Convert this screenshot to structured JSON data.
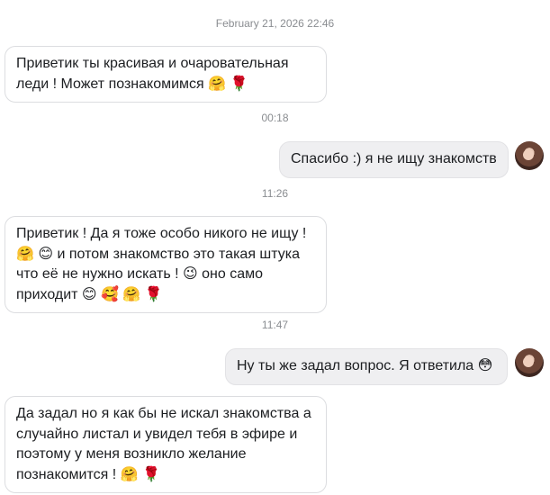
{
  "timestamps": {
    "t1": "February 21, 2026 22:46",
    "t2": "00:18",
    "t3": "11:26",
    "t4": "11:47"
  },
  "messages": [
    {
      "from": "them",
      "text": "Приветик ты красивая и очаровательная леди ! Может познакомимся 🤗 🌹"
    },
    {
      "from": "me",
      "text": "Спасибо :) я не ищу знакомств"
    },
    {
      "from": "them",
      "text": "Приветик ! Да я тоже особо никого не ищу ! 🤗 😊  и потом знакомство это такая штука что её не нужно искать ! 😉  оно само приходит 😊 🥰 🤗 🌹"
    },
    {
      "from": "me",
      "text": "Ну ты же задал вопрос. Я ответила 😳"
    },
    {
      "from": "them",
      "text": "Да задал но я как бы не искал знакомства а случайно листал и увидел тебя в эфире и поэтому у меня возникло желание познакомится ! 🤗 🌹"
    }
  ],
  "colors": {
    "incoming_bg": "#ffffff",
    "outgoing_bg": "#efeff1",
    "timestamp": "#8a8d91",
    "text": "#1c1e21"
  }
}
